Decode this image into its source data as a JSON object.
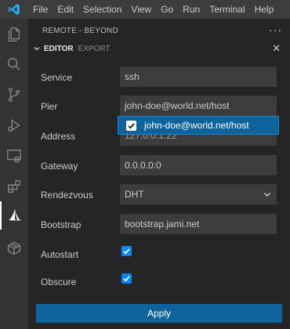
{
  "menubar": {
    "items": [
      "File",
      "Edit",
      "Selection",
      "View",
      "Go",
      "Run",
      "Terminal",
      "Help"
    ]
  },
  "colors": {
    "accent": "#0e639c",
    "checkbox": "#0a84ff",
    "vscode_logo": "#23a9f2"
  },
  "activity_bar": {
    "icons": [
      "files-icon",
      "search-icon",
      "source-control-icon",
      "run-debug-icon",
      "remote-explorer-icon",
      "extensions-icon",
      "beyond-sail-icon",
      "package-icon"
    ],
    "active": "beyond-sail-icon"
  },
  "sidebar": {
    "title": "REMOTE - BEYOND",
    "more": "···",
    "section": {
      "title": "EDITOR",
      "subtitle": "EXPORT",
      "close": "✕"
    }
  },
  "form": {
    "service": {
      "label": "Service",
      "value": "ssh"
    },
    "pier": {
      "label": "Pier",
      "value": "john-doe@world.net/host"
    },
    "address": {
      "label": "Address",
      "value": "127.0.0.1:22"
    },
    "gateway": {
      "label": "Gateway",
      "value": "0.0.0.0:0"
    },
    "rendezvous": {
      "label": "Rendezvous",
      "value": "DHT"
    },
    "bootstrap": {
      "label": "Bootstrap",
      "value": "bootstrap.jami.net"
    },
    "autostart": {
      "label": "Autostart",
      "checked": true
    },
    "obscure": {
      "label": "Obscure",
      "checked": true
    }
  },
  "suggestion": {
    "text": "john-doe@world.net/host",
    "checked": true
  },
  "apply_label": "Apply"
}
